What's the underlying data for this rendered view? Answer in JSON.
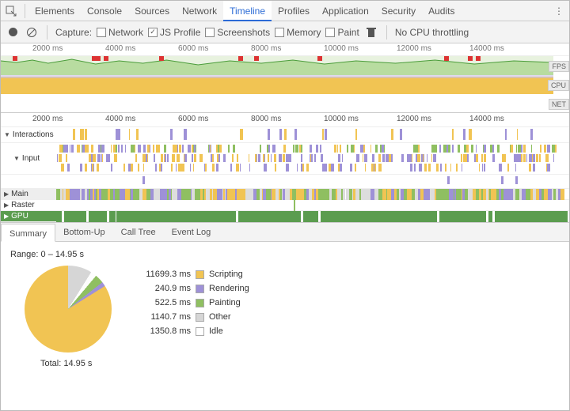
{
  "tabs": [
    "Elements",
    "Console",
    "Sources",
    "Network",
    "Timeline",
    "Profiles",
    "Application",
    "Security",
    "Audits"
  ],
  "active_tab": "Timeline",
  "toolbar": {
    "capture_label": "Capture:",
    "opts": {
      "network": "Network",
      "jsprofile": "JS Profile",
      "screenshots": "Screenshots",
      "memory": "Memory",
      "paint": "Paint"
    },
    "throttle": "No CPU throttling"
  },
  "overview": {
    "ticks": [
      "2000 ms",
      "4000 ms",
      "6000 ms",
      "8000 ms",
      "10000 ms",
      "12000 ms",
      "14000 ms"
    ],
    "labels": {
      "fps": "FPS",
      "cpu": "CPU",
      "net": "NET"
    }
  },
  "flame": {
    "ticks": [
      "2000 ms",
      "4000 ms",
      "6000 ms",
      "8000 ms",
      "10000 ms",
      "12000 ms",
      "14000 ms"
    ],
    "tracks": {
      "interactions": "Interactions",
      "input": "Input",
      "main": "Main",
      "raster": "Raster",
      "gpu": "GPU"
    }
  },
  "summary": {
    "tabs": [
      "Summary",
      "Bottom-Up",
      "Call Tree",
      "Event Log"
    ],
    "range": "Range: 0 – 14.95 s",
    "total": "Total: 14.95 s",
    "legend": [
      {
        "ms": "11699.3 ms",
        "label": "Scripting",
        "color": "#f1c453"
      },
      {
        "ms": "240.9 ms",
        "label": "Rendering",
        "color": "#9e91d7"
      },
      {
        "ms": "522.5 ms",
        "label": "Painting",
        "color": "#8fbf61"
      },
      {
        "ms": "1140.7 ms",
        "label": "Other",
        "color": "#d6d6d6"
      },
      {
        "ms": "1350.8 ms",
        "label": "Idle",
        "color": "#ffffff"
      }
    ]
  },
  "chart_data": {
    "type": "pie",
    "title": "Time breakdown",
    "series": [
      {
        "name": "Scripting",
        "value": 11699.3,
        "color": "#f1c453"
      },
      {
        "name": "Rendering",
        "value": 240.9,
        "color": "#9e91d7"
      },
      {
        "name": "Painting",
        "value": 522.5,
        "color": "#8fbf61"
      },
      {
        "name": "Other",
        "value": 1140.7,
        "color": "#d6d6d6"
      },
      {
        "name": "Idle",
        "value": 1350.8,
        "color": "#ffffff"
      }
    ],
    "total_seconds": 14.95
  }
}
